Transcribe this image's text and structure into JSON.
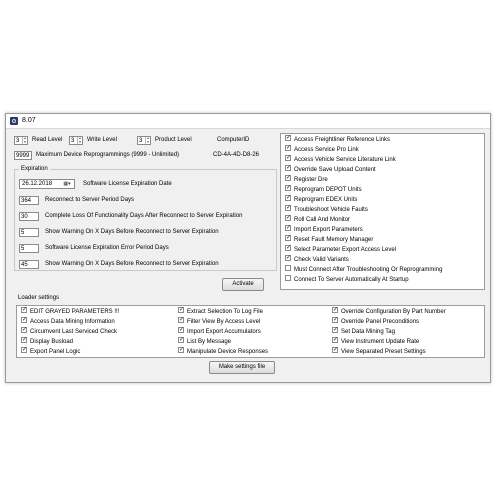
{
  "window": {
    "title": "8.07"
  },
  "levels": {
    "read": {
      "value": "3",
      "label": "Read Level"
    },
    "write": {
      "value": "3",
      "label": "Write Level"
    },
    "product": {
      "value": "3",
      "label": "Product Level"
    }
  },
  "computer": {
    "label": "ComputerID",
    "id": "CD-4A-4D-D8-26"
  },
  "max_reprogrammings": {
    "value": "9999",
    "label": "Maximum Device Reprogrammings (9999 - Unlimited)"
  },
  "expiration": {
    "title": "Expiration",
    "date": "26.12.2018",
    "date_label": "Software License Expiration Date",
    "rows": [
      {
        "value": "364",
        "label": "Reconnect to Server Period Days"
      },
      {
        "value": "30",
        "label": "Complete Loss Of Functionality Days After Reconnect to Server Expiration"
      },
      {
        "value": "5",
        "label": "Show Warning On X Days Before Reconnect to Server Expiration"
      },
      {
        "value": "5",
        "label": "Software License Expiration Error Period Days"
      },
      {
        "value": "45",
        "label": "Show Warning On X Days Before Reconnect to Server Expiration"
      }
    ]
  },
  "activate_label": "Activate",
  "permissions": [
    {
      "label": "Access Freightliner Reference Links",
      "checked": true
    },
    {
      "label": "Access Service Pro Link",
      "checked": true
    },
    {
      "label": "Access Vehicle Service Literature Link",
      "checked": true
    },
    {
      "label": "Override Save Upload Content",
      "checked": true
    },
    {
      "label": "Register Dre",
      "checked": true
    },
    {
      "label": "Reprogram DEPOT Units",
      "checked": true
    },
    {
      "label": "Reprogram EDEX Units",
      "checked": true
    },
    {
      "label": "Troubleshoot Vehicle Faults",
      "checked": true
    },
    {
      "label": "Roll Call And Monitor",
      "checked": true
    },
    {
      "label": "Import Export Parameters",
      "checked": true
    },
    {
      "label": "Reset Fault Memory Manager",
      "checked": true
    },
    {
      "label": "Select Parameter Export Access Level",
      "checked": true
    },
    {
      "label": "Check Valid Variants",
      "checked": true
    },
    {
      "label": "Must Connect After Troubleshooting Or Reprogramming",
      "checked": false
    },
    {
      "label": "Connect To Server Automatically At Startup",
      "checked": false
    }
  ],
  "loader": {
    "title": "Loader settings",
    "col1": [
      {
        "label": "EDIT GRAYED PARAMETERS !!!",
        "checked": true
      },
      {
        "label": "Access Data Mining Information",
        "checked": true
      },
      {
        "label": "Circumvent Last Serviced Check",
        "checked": true
      },
      {
        "label": "Display Busload",
        "checked": true
      },
      {
        "label": "Export Panel Logic",
        "checked": true
      }
    ],
    "col2": [
      {
        "label": "Extract Selection To Log File",
        "checked": true
      },
      {
        "label": "Filter View By Access Level",
        "checked": true
      },
      {
        "label": "Import Export Accumulators",
        "checked": true
      },
      {
        "label": "List By Message",
        "checked": true
      },
      {
        "label": "Manipulate Device Responses",
        "checked": true
      }
    ],
    "col3": [
      {
        "label": "Override Configuration By Part Number",
        "checked": true
      },
      {
        "label": "Override Panel Preconditions",
        "checked": true
      },
      {
        "label": "Set Data Mining Tag",
        "checked": true
      },
      {
        "label": "View Instrument Update Rate",
        "checked": true
      },
      {
        "label": "View Separated Preset Settings",
        "checked": true
      }
    ]
  },
  "make_settings_label": "Make settings file"
}
